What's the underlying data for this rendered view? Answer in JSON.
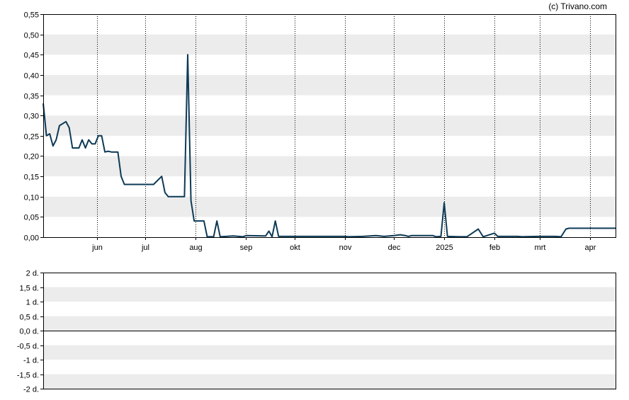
{
  "copyright": "(c) Trivano.com",
  "colors": {
    "line": "#0d3a56",
    "band": "#ececec",
    "vgrid": "#000000",
    "frame": "#000000",
    "zero_line": "#000000"
  },
  "chart_data": [
    {
      "type": "line",
      "title": "",
      "xlabel": "",
      "ylabel": "",
      "ylim": [
        0,
        0.55
      ],
      "yticks": [
        {
          "v": 0.55,
          "label": "0,55"
        },
        {
          "v": 0.5,
          "label": "0,50"
        },
        {
          "v": 0.45,
          "label": "0,45"
        },
        {
          "v": 0.4,
          "label": "0,40"
        },
        {
          "v": 0.35,
          "label": "0,35"
        },
        {
          "v": 0.3,
          "label": "0,30"
        },
        {
          "v": 0.25,
          "label": "0,25"
        },
        {
          "v": 0.2,
          "label": "0,20"
        },
        {
          "v": 0.15,
          "label": "0,15"
        },
        {
          "v": 0.1,
          "label": "0,10"
        },
        {
          "v": 0.05,
          "label": "0,05"
        },
        {
          "v": 0.0,
          "label": "0,00"
        }
      ],
      "xlim": [
        "2024-04-29",
        "2025-04-17"
      ],
      "xticks": [
        {
          "date": "2024-06-01",
          "label": "jun"
        },
        {
          "date": "2024-07-01",
          "label": "jul"
        },
        {
          "date": "2024-08-01",
          "label": "aug"
        },
        {
          "date": "2024-09-01",
          "label": "sep"
        },
        {
          "date": "2024-10-01",
          "label": "okt"
        },
        {
          "date": "2024-11-01",
          "label": "nov"
        },
        {
          "date": "2024-12-01",
          "label": "dec"
        },
        {
          "date": "2025-01-01",
          "label": "2025"
        },
        {
          "date": "2025-02-01",
          "label": "feb"
        },
        {
          "date": "2025-03-01",
          "label": "mrt"
        },
        {
          "date": "2025-04-01",
          "label": "apr"
        }
      ],
      "grid": {
        "horizontal_bands": true,
        "vertical_dotted": true
      },
      "series": [
        {
          "values": [
            [
              "2024-04-29",
              0.33
            ],
            [
              "2024-05-01",
              0.25
            ],
            [
              "2024-05-03",
              0.255
            ],
            [
              "2024-05-05",
              0.225
            ],
            [
              "2024-05-07",
              0.24
            ],
            [
              "2024-05-09",
              0.275
            ],
            [
              "2024-05-13",
              0.285
            ],
            [
              "2024-05-15",
              0.27
            ],
            [
              "2024-05-17",
              0.22
            ],
            [
              "2024-05-21",
              0.22
            ],
            [
              "2024-05-23",
              0.24
            ],
            [
              "2024-05-25",
              0.22
            ],
            [
              "2024-05-27",
              0.24
            ],
            [
              "2024-05-29",
              0.23
            ],
            [
              "2024-05-31",
              0.23
            ],
            [
              "2024-06-02",
              0.25
            ],
            [
              "2024-06-04",
              0.25
            ],
            [
              "2024-06-06",
              0.21
            ],
            [
              "2024-06-08",
              0.212
            ],
            [
              "2024-06-10",
              0.21
            ],
            [
              "2024-06-14",
              0.21
            ],
            [
              "2024-06-16",
              0.15
            ],
            [
              "2024-06-18",
              0.13
            ],
            [
              "2024-06-22",
              0.13
            ],
            [
              "2024-07-06",
              0.13
            ],
            [
              "2024-07-11",
              0.15
            ],
            [
              "2024-07-13",
              0.11
            ],
            [
              "2024-07-15",
              0.1
            ],
            [
              "2024-07-25",
              0.1
            ],
            [
              "2024-07-27",
              0.45
            ],
            [
              "2024-07-29",
              0.09
            ],
            [
              "2024-07-31",
              0.04
            ],
            [
              "2024-08-06",
              0.04
            ],
            [
              "2024-08-08",
              0.001
            ],
            [
              "2024-08-12",
              0.001
            ],
            [
              "2024-08-14",
              0.04
            ],
            [
              "2024-08-16",
              0.001
            ],
            [
              "2024-08-20",
              0.002
            ],
            [
              "2024-08-24",
              0.003
            ],
            [
              "2024-08-30",
              0.001
            ],
            [
              "2024-09-01",
              0.004
            ],
            [
              "2024-09-13",
              0.003
            ],
            [
              "2024-09-15",
              0.015
            ],
            [
              "2024-09-17",
              0.001
            ],
            [
              "2024-09-19",
              0.04
            ],
            [
              "2024-09-21",
              0.002
            ],
            [
              "2024-10-01",
              0.002
            ],
            [
              "2024-11-01",
              0.002
            ],
            [
              "2024-11-03",
              0.001
            ],
            [
              "2024-11-12",
              0.002
            ],
            [
              "2024-11-20",
              0.004
            ],
            [
              "2024-11-25",
              0.002
            ],
            [
              "2024-12-01",
              0.004
            ],
            [
              "2024-12-05",
              0.006
            ],
            [
              "2024-12-08",
              0.004
            ],
            [
              "2024-12-10",
              0.002
            ],
            [
              "2024-12-12",
              0.004
            ],
            [
              "2024-12-25",
              0.004
            ],
            [
              "2024-12-27",
              0.001
            ],
            [
              "2024-12-30",
              0.002
            ],
            [
              "2025-01-01",
              0.085
            ],
            [
              "2025-01-03",
              0.002
            ],
            [
              "2025-01-10",
              0.001
            ],
            [
              "2025-01-15",
              0.001
            ],
            [
              "2025-01-22",
              0.02
            ],
            [
              "2025-01-25",
              0.001
            ],
            [
              "2025-02-01",
              0.01
            ],
            [
              "2025-02-03",
              0.002
            ],
            [
              "2025-02-15",
              0.002
            ],
            [
              "2025-02-18",
              0.001
            ],
            [
              "2025-02-28",
              0.002
            ],
            [
              "2025-03-10",
              0.002
            ],
            [
              "2025-03-14",
              0.001
            ],
            [
              "2025-03-17",
              0.02
            ],
            [
              "2025-03-19",
              0.022
            ],
            [
              "2025-04-17",
              0.022
            ]
          ]
        }
      ]
    },
    {
      "type": "line",
      "title": "",
      "xlabel": "",
      "ylabel": "",
      "ylim": [
        -2,
        2
      ],
      "yticks": [
        {
          "v": 2,
          "label": "2 d."
        },
        {
          "v": 1.5,
          "label": "1,5 d."
        },
        {
          "v": 1,
          "label": "1 d."
        },
        {
          "v": 0.5,
          "label": "0,5 d."
        },
        {
          "v": 0,
          "label": "0,0 d."
        },
        {
          "v": -0.5,
          "label": "-0,5 d."
        },
        {
          "v": -1,
          "label": "-1 d."
        },
        {
          "v": -1.5,
          "label": "-1,5 d."
        },
        {
          "v": -2,
          "label": "-2 d."
        }
      ],
      "grid": {
        "horizontal_bands": true,
        "vertical_dotted": false
      },
      "zero_line": true,
      "series": []
    }
  ]
}
